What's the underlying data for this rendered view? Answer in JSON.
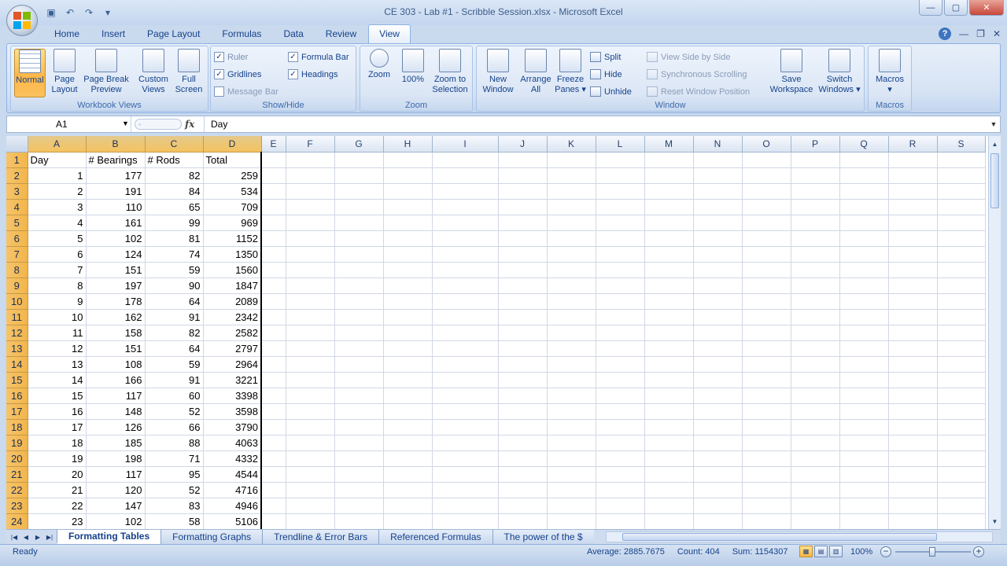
{
  "window": {
    "title": "CE 303 - Lab #1 - Scribble Session.xlsx - Microsoft Excel",
    "minimize": "—",
    "maximize": "▢",
    "close": "✕"
  },
  "ribbon_tabs": [
    "Home",
    "Insert",
    "Page Layout",
    "Formulas",
    "Data",
    "Review",
    "View"
  ],
  "active_tab": "View",
  "ribbon": {
    "workbook_views": {
      "label": "Workbook Views",
      "normal": "Normal",
      "page_layout": [
        "Page",
        "Layout"
      ],
      "page_break": [
        "Page Break",
        "Preview"
      ],
      "custom_views": [
        "Custom",
        "Views"
      ],
      "full_screen": [
        "Full",
        "Screen"
      ]
    },
    "show_hide": {
      "label": "Show/Hide",
      "ruler": "Ruler",
      "gridlines": "Gridlines",
      "message_bar": "Message Bar",
      "formula_bar": "Formula Bar",
      "headings": "Headings"
    },
    "zoom": {
      "label": "Zoom",
      "zoom": "Zoom",
      "hundred": "100%",
      "zoom_to_selection": [
        "Zoom to",
        "Selection"
      ]
    },
    "window_group": {
      "label": "Window",
      "new_window": [
        "New",
        "Window"
      ],
      "arrange_all": [
        "Arrange",
        "All"
      ],
      "freeze_panes": [
        "Freeze",
        "Panes ▾"
      ],
      "split": "Split",
      "hide": "Hide",
      "unhide": "Unhide",
      "view_side_by_side": "View Side by Side",
      "sync_scrolling": "Synchronous Scrolling",
      "reset_position": "Reset Window Position",
      "save_workspace": [
        "Save",
        "Workspace"
      ],
      "switch_windows": [
        "Switch",
        "Windows ▾"
      ]
    },
    "macros": {
      "label": "Macros",
      "macros": "Macros"
    }
  },
  "formula_bar": {
    "name_box": "A1",
    "fx": "fx",
    "content": "Day"
  },
  "columns": [
    "A",
    "B",
    "C",
    "D",
    "E",
    "F",
    "G",
    "H",
    "I",
    "J",
    "K",
    "L",
    "M",
    "N",
    "O",
    "P",
    "Q",
    "R",
    "S"
  ],
  "header_row": [
    "Day",
    "# Bearings",
    "# Rods",
    "Total"
  ],
  "rows": [
    [
      1,
      177,
      82,
      259
    ],
    [
      2,
      191,
      84,
      534
    ],
    [
      3,
      110,
      65,
      709
    ],
    [
      4,
      161,
      99,
      969
    ],
    [
      5,
      102,
      81,
      1152
    ],
    [
      6,
      124,
      74,
      1350
    ],
    [
      7,
      151,
      59,
      1560
    ],
    [
      8,
      197,
      90,
      1847
    ],
    [
      9,
      178,
      64,
      2089
    ],
    [
      10,
      162,
      91,
      2342
    ],
    [
      11,
      158,
      82,
      2582
    ],
    [
      12,
      151,
      64,
      2797
    ],
    [
      13,
      108,
      59,
      2964
    ],
    [
      14,
      166,
      91,
      3221
    ],
    [
      15,
      117,
      60,
      3398
    ],
    [
      16,
      148,
      52,
      3598
    ],
    [
      17,
      126,
      66,
      3790
    ],
    [
      18,
      185,
      88,
      4063
    ],
    [
      19,
      198,
      71,
      4332
    ],
    [
      20,
      117,
      95,
      4544
    ],
    [
      21,
      120,
      52,
      4716
    ],
    [
      22,
      147,
      83,
      4946
    ],
    [
      23,
      102,
      58,
      5106
    ]
  ],
  "sheet_tabs": [
    "Formatting Tables",
    "Formatting Graphs",
    "Trendline & Error Bars",
    "Referenced Formulas",
    "The power of the $"
  ],
  "active_sheet": "Formatting Tables",
  "status": {
    "ready": "Ready",
    "average": "Average: 2885.7675",
    "count": "Count: 404",
    "sum": "Sum: 1154307",
    "zoom": "100%"
  }
}
